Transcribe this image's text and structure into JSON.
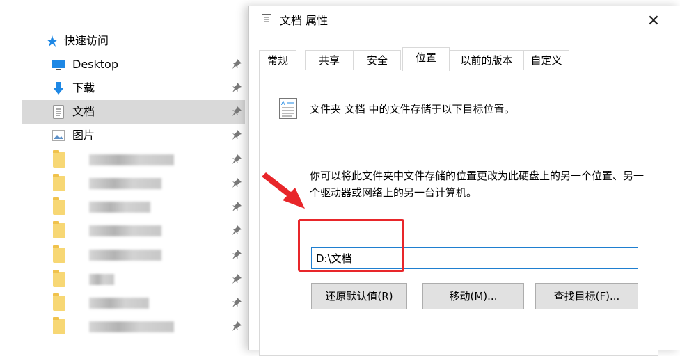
{
  "explorer": {
    "quick_access_label": "快速访问",
    "items": [
      {
        "label": "Desktop",
        "icon": "desktop-icon"
      },
      {
        "label": "下载",
        "icon": "download-arrow-icon"
      },
      {
        "label": "文档",
        "icon": "document-icon",
        "selected": true
      },
      {
        "label": "图片",
        "icon": "pictures-icon"
      }
    ],
    "blurred_folder_count": 8
  },
  "dialog": {
    "title": "文档 属性",
    "close_glyph": "✕",
    "tabs": [
      "常规",
      "共享",
      "安全",
      "位置",
      "以前的版本",
      "自定义"
    ],
    "active_tab": "位置",
    "description_line1": "文件夹 文档 中的文件存储于以下目标位置。",
    "description_line2": "你可以将此文件夹中文件存储的位置更改为此硬盘上的另一个位置、另一个驱动器或网络上的另一台计算机。",
    "path_value": "D:\\文档",
    "buttons": {
      "restore_default": "还原默认值(R)",
      "move": "移动(M)...",
      "find_target": "查找目标(F)..."
    }
  },
  "annotation": {
    "color": "#e8262a"
  },
  "colors": {
    "selected_bg": "#d9d9d9",
    "input_border": "#1f7fd0",
    "pin": "#7a7a7a",
    "accent_blue": "#1e88e5"
  }
}
